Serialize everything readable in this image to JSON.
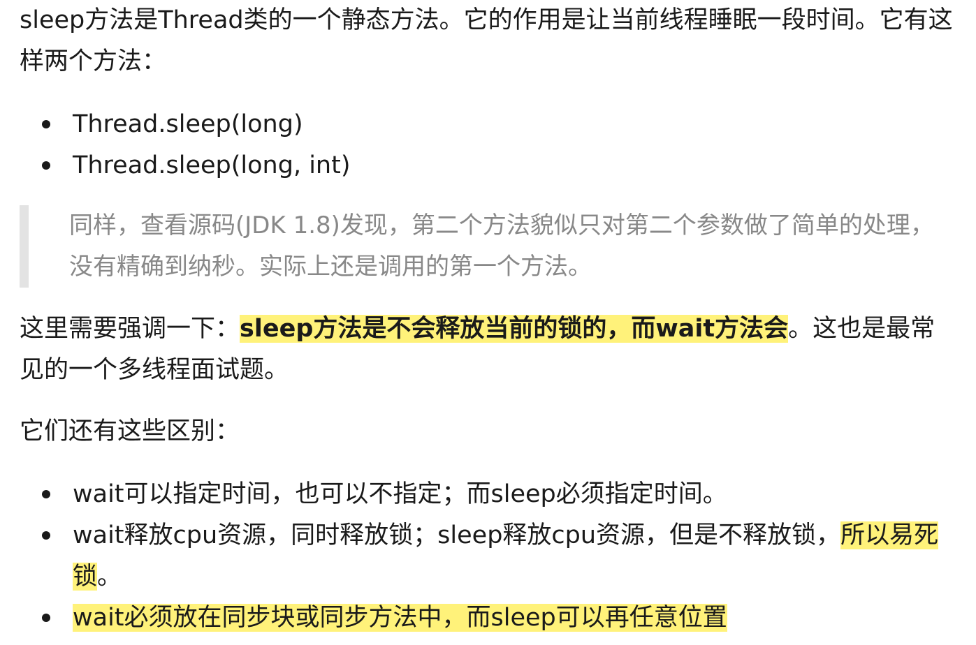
{
  "intro": {
    "text": "sleep方法是Thread类的一个静态方法。它的作用是让当前线程睡眠一段时间。它有这样两个方法："
  },
  "methods": [
    "Thread.sleep(long)",
    "Thread.sleep(long, int)"
  ],
  "note": {
    "text": "同样，查看源码(JDK 1.8)发现，第二个方法貌似只对第二个参数做了简单的处理，没有精确到纳秒。实际上还是调用的第一个方法。"
  },
  "emphasis": {
    "prefix": "这里需要强调一下：",
    "highlight": "sleep方法是不会释放当前的锁的，而wait方法会",
    "suffix": "。这也是最常见的一个多线程面试题。"
  },
  "differences_intro": {
    "text": "它们还有这些区别："
  },
  "differences": [
    {
      "text": "wait可以指定时间，也可以不指定；而sleep必须指定时间。"
    },
    {
      "text": "wait释放cpu资源，同时释放锁；sleep释放cpu资源，但是不释放锁，",
      "highlight": "所以易死锁",
      "suffix": "。"
    },
    {
      "highlight": "wait必须放在同步块或同步方法中，而sleep可以再任意位置"
    }
  ],
  "colors": {
    "highlight": "#fff27a",
    "quote_border": "#e3e3e3",
    "quote_text": "#888888",
    "body_text": "#1a1a1a"
  }
}
